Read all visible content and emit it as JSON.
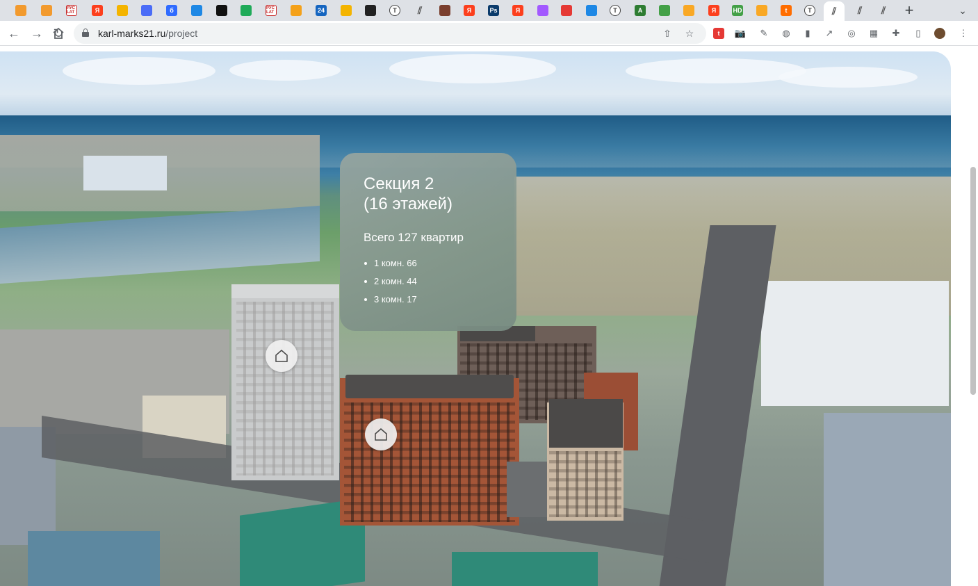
{
  "browser": {
    "tabs": [
      {
        "icon": "orange-blob-icon",
        "label": "",
        "color": "#f29a2e"
      },
      {
        "icon": "orange-blob-icon",
        "label": "",
        "color": "#f29a2e"
      },
      {
        "icon": "rus-lat-icon",
        "label": "РУС LAT",
        "color": "#c62828"
      },
      {
        "icon": "yandex-icon",
        "label": "Я",
        "color": "#fc3f1d"
      },
      {
        "icon": "mail-icon",
        "label": "",
        "color": "#f4b400"
      },
      {
        "icon": "blue-square-icon",
        "label": "",
        "color": "#4a6cf7"
      },
      {
        "icon": "b-icon",
        "label": "б",
        "color": "#2f6bff"
      },
      {
        "icon": "chat-icon",
        "label": "",
        "color": "#1e88e5"
      },
      {
        "icon": "terminal-icon",
        "label": "",
        "color": "#111111"
      },
      {
        "icon": "plus-sheet-icon",
        "label": "",
        "color": "#1faa59"
      },
      {
        "icon": "rus-lat-icon",
        "label": "РУС LAT",
        "color": "#c62828"
      },
      {
        "icon": "orange-swoosh-icon",
        "label": "",
        "color": "#f4a11a"
      },
      {
        "icon": "number-24-icon",
        "label": "24",
        "color": "#1565c0"
      },
      {
        "icon": "mail-icon",
        "label": "",
        "color": "#f4b400"
      },
      {
        "icon": "dark-badge-icon",
        "label": "",
        "color": "#222222"
      },
      {
        "icon": "t-circle-icon",
        "label": "T",
        "color": "#444444"
      },
      {
        "icon": "chart-icon",
        "label": "",
        "color": "#555555"
      },
      {
        "icon": "avatar-icon",
        "label": "",
        "color": "#7a3e2e"
      },
      {
        "icon": "yandex-icon",
        "label": "Я",
        "color": "#fc3f1d"
      },
      {
        "icon": "photoshop-icon",
        "label": "Ps",
        "color": "#0b3b6b"
      },
      {
        "icon": "yandex-icon",
        "label": "Я",
        "color": "#fc3f1d"
      },
      {
        "icon": "figma-icon",
        "label": "",
        "color": "#a259ff"
      },
      {
        "icon": "circle-multi-icon",
        "label": "",
        "color": "#e53935"
      },
      {
        "icon": "circle-multi-icon",
        "label": "",
        "color": "#1e88e5"
      },
      {
        "icon": "t-circle-icon",
        "label": "T",
        "color": "#444444"
      },
      {
        "icon": "a-icon",
        "label": "A",
        "color": "#2e7d32"
      },
      {
        "icon": "green-bar-icon",
        "label": "",
        "color": "#43a047"
      },
      {
        "icon": "lock-icon",
        "label": "",
        "color": "#f9a825"
      },
      {
        "icon": "yandex-icon",
        "label": "Я",
        "color": "#fc3f1d"
      },
      {
        "icon": "hd-icon",
        "label": "HD",
        "color": "#43a047"
      },
      {
        "icon": "lock-icon",
        "label": "",
        "color": "#f9a825"
      },
      {
        "icon": "t-orange-icon",
        "label": "t",
        "color": "#ff6d00"
      },
      {
        "icon": "t-circle-icon",
        "label": "T",
        "color": "#444444"
      },
      {
        "icon": "chart-icon",
        "label": "",
        "color": "#555555",
        "active": true
      },
      {
        "icon": "chart-icon",
        "label": "",
        "color": "#555555"
      },
      {
        "icon": "chart-icon",
        "label": "",
        "color": "#555555"
      }
    ],
    "close_glyph": "✕",
    "new_tab_glyph": "+",
    "tab_search_glyph": "⌄",
    "url_host": "karl-marks21.ru",
    "url_path": "/project"
  },
  "card": {
    "title_line1": "Секция 2",
    "title_line2": "(16 этажей)",
    "total": "Всего 127 квартир",
    "items": [
      "1 комн. 66",
      "2 комн. 44",
      "3 комн. 17"
    ]
  }
}
